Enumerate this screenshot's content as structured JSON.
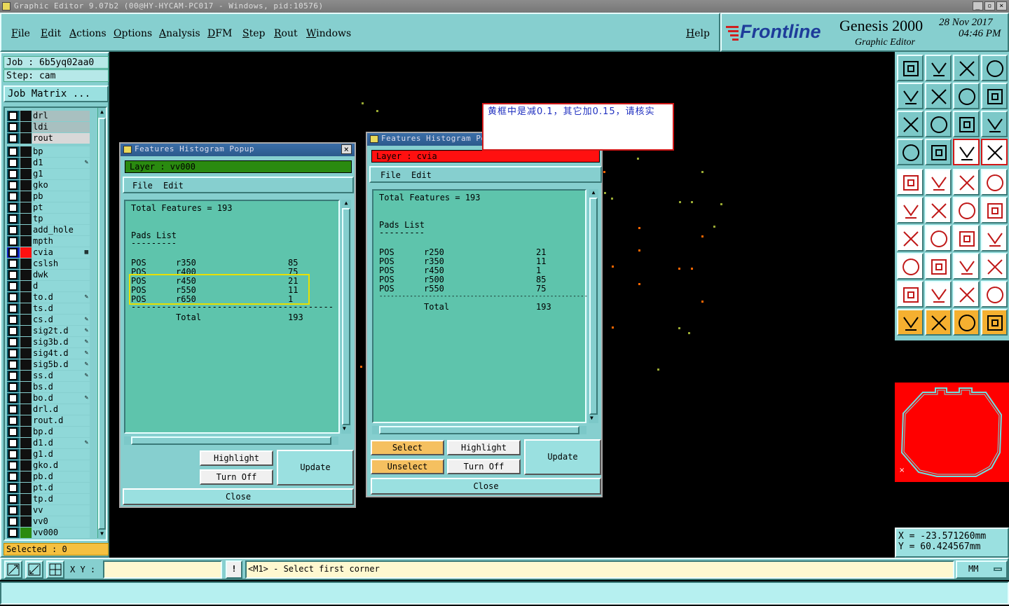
{
  "title": "Graphic Editor 9.07b2 (00@HY-HYCAM-PC017 - Windows, pid:10576)",
  "menu": [
    "File",
    "Edit",
    "Actions",
    "Options",
    "Analysis",
    "DFM",
    "Step",
    "Rout",
    "Windows"
  ],
  "help": "Help",
  "brand": {
    "logo": "Frontline",
    "product": "Genesis 2000",
    "subtitle": "Graphic Editor",
    "date": "28 Nov 2017",
    "time": "04:46 PM"
  },
  "job": {
    "job": "Job : 6b5yq02aa0",
    "step": "Step: cam",
    "matrix": "Job Matrix ..."
  },
  "layers": [
    {
      "name": "drl"
    },
    {
      "name": "ldi"
    },
    {
      "name": "rout"
    },
    {
      "name": "bp"
    },
    {
      "name": "d1",
      "mark": "✎"
    },
    {
      "name": "g1"
    },
    {
      "name": "gko"
    },
    {
      "name": "pb"
    },
    {
      "name": "pt"
    },
    {
      "name": "tp"
    },
    {
      "name": "add_hole"
    },
    {
      "name": "mpth"
    },
    {
      "name": "cvia",
      "mark": "▦"
    },
    {
      "name": "cslsh"
    },
    {
      "name": "dwk"
    },
    {
      "name": "d"
    },
    {
      "name": "to.d",
      "mark": "✎"
    },
    {
      "name": "ts.d"
    },
    {
      "name": "cs.d",
      "mark": "✎"
    },
    {
      "name": "sig2t.d",
      "mark": "✎"
    },
    {
      "name": "sig3b.d",
      "mark": "✎"
    },
    {
      "name": "sig4t.d",
      "mark": "✎"
    },
    {
      "name": "sig5b.d",
      "mark": "✎"
    },
    {
      "name": "ss.d",
      "mark": "✎"
    },
    {
      "name": "bs.d"
    },
    {
      "name": "bo.d",
      "mark": "✎"
    },
    {
      "name": "drl.d"
    },
    {
      "name": "rout.d"
    },
    {
      "name": "bp.d"
    },
    {
      "name": "d1.d",
      "mark": "✎"
    },
    {
      "name": "g1.d"
    },
    {
      "name": "gko.d"
    },
    {
      "name": "pb.d"
    },
    {
      "name": "pt.d"
    },
    {
      "name": "tp.d"
    },
    {
      "name": "vv"
    },
    {
      "name": "vv0"
    },
    {
      "name": "vv000"
    }
  ],
  "selected": "Selected : 0",
  "popup1": {
    "title": "Features Histogram Popup",
    "layer": "Layer :  vv000",
    "file": "File",
    "edit": "Edit",
    "total": "Total Features = 193",
    "list_title": "Pads List",
    "underline": "---------",
    "rows": [
      [
        "POS",
        "r350",
        "85"
      ],
      [
        "POS",
        "r400",
        "75"
      ],
      [
        "POS",
        "r450",
        "21"
      ],
      [
        "POS",
        "r550",
        "11"
      ],
      [
        "POS",
        "r650",
        "1"
      ]
    ],
    "sep": "----------------------------------------",
    "total_label": "Total",
    "total_value": "193",
    "btn_highlight": "Highlight",
    "btn_turnoff": "Turn Off",
    "btn_update": "Update",
    "btn_close": "Close"
  },
  "popup2": {
    "title": "Features Histogram Popup",
    "layer": "Layer :  cvia",
    "file": "File",
    "edit": "Edit",
    "total": "Total Features = 193",
    "list_title": "Pads List",
    "underline": "---------",
    "rows": [
      [
        "POS",
        "r250",
        "21"
      ],
      [
        "POS",
        "r350",
        "11"
      ],
      [
        "POS",
        "r450",
        "1"
      ],
      [
        "POS",
        "r500",
        "85"
      ],
      [
        "POS",
        "r550",
        "75"
      ]
    ],
    "sep": "----------------------------------------------------------",
    "total_label": "Total",
    "total_value": "193",
    "btn_select": "Select",
    "btn_unselect": "Unselect",
    "btn_highlight": "Highlight",
    "btn_turnoff": "Turn Off",
    "btn_update": "Update",
    "btn_close": "Close"
  },
  "note": "黄框中是减0.1，其它加0.15，请核实",
  "coords": {
    "x": "X = -23.571260mm",
    "y": "Y =  60.424567mm"
  },
  "status": {
    "xy_label": "X Y :",
    "xy_value": "",
    "prompt": "<M1> - Select first corner",
    "units": "MM"
  },
  "colors": {
    "teal": "#86cfcf",
    "active_layer": "#ff1010",
    "vv000": "#2a8a10",
    "highlight_box": "#e8e000",
    "board": "#ff0000"
  }
}
